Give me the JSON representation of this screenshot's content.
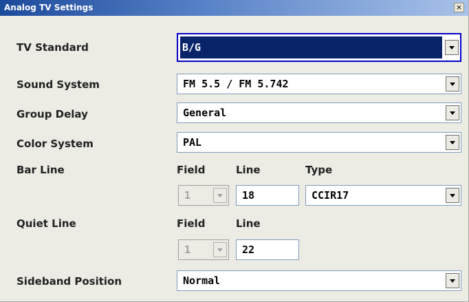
{
  "window": {
    "title": "Analog TV Settings",
    "close_glyph": "×"
  },
  "rows": {
    "tv_standard": {
      "label": "TV Standard",
      "value": "B/G"
    },
    "sound_system": {
      "label": "Sound System",
      "value": "FM 5.5 / FM 5.742"
    },
    "group_delay": {
      "label": "Group Delay",
      "value": "General"
    },
    "color_system": {
      "label": "Color System",
      "value": "PAL"
    },
    "bar_line": {
      "label": "Bar Line",
      "field_label": "Field",
      "line_label": "Line",
      "type_label": "Type",
      "field_value": "1",
      "line_value": "18",
      "type_value": "CCIR17"
    },
    "quiet_line": {
      "label": "Quiet Line",
      "field_label": "Field",
      "line_label": "Line",
      "field_value": "1",
      "line_value": "22"
    },
    "sideband_position": {
      "label": "Sideband Position",
      "value": "Normal"
    }
  },
  "colors": {
    "title_start": "#1c4a9c",
    "focus_border": "#0000c8",
    "selection": "#0a246a",
    "dialog_bg": "#ecebe4"
  }
}
